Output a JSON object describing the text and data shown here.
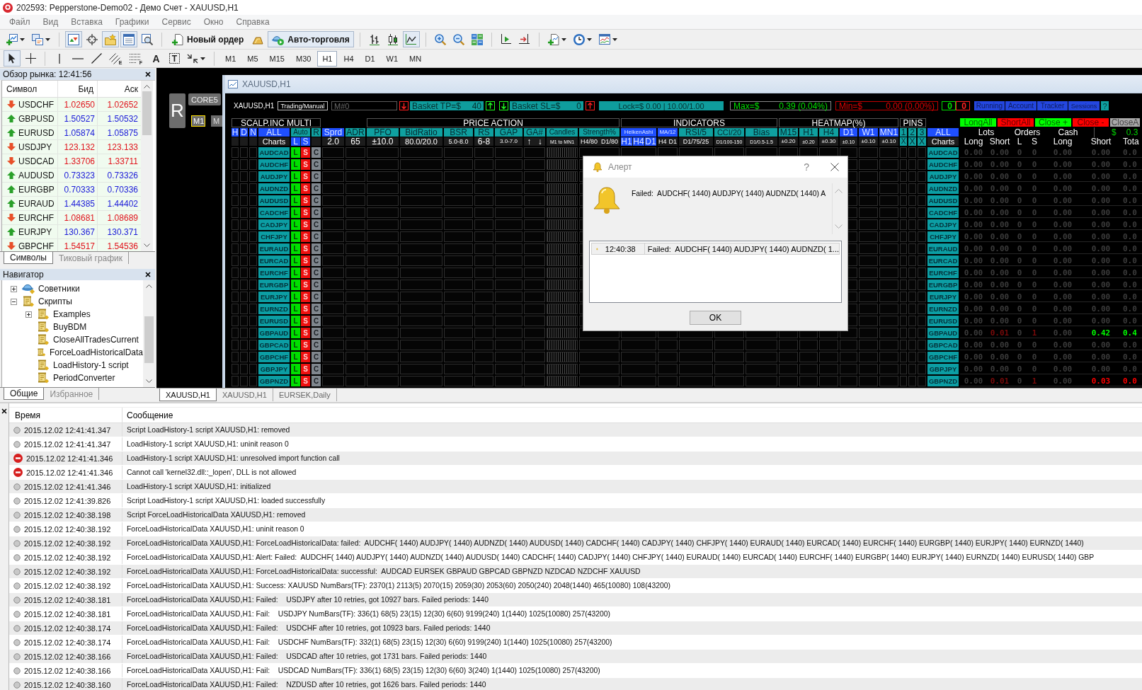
{
  "window": {
    "title": "202593: Pepperstone-Demo02 - Демо Счет - XAUUSD,H1"
  },
  "menu": [
    "Файл",
    "Вид",
    "Вставка",
    "Графики",
    "Сервис",
    "Окно",
    "Справка"
  ],
  "toolbar": [
    [
      {
        "kind": "new-chart",
        "dropdown": true,
        "pressed": false
      },
      {
        "kind": "profiles",
        "dropdown": true,
        "pressed": false
      }
    ],
    [
      {
        "kind": "market-watch",
        "pressed": true
      },
      {
        "kind": "data-window",
        "pressed": false
      },
      {
        "kind": "navigator",
        "pressed": true
      },
      {
        "kind": "terminal",
        "pressed": true
      },
      {
        "kind": "tester",
        "pressed": false
      }
    ],
    [
      {
        "kind": "new-order",
        "label": "Новый ордер",
        "pressed": false
      },
      {
        "kind": "gold",
        "pressed": false
      },
      {
        "kind": "autotrade",
        "label": "Авто-торговля",
        "pressed": true
      }
    ],
    [
      {
        "kind": "bars",
        "pressed": false
      },
      {
        "kind": "candles",
        "pressed": false
      },
      {
        "kind": "line",
        "pressed": true
      }
    ],
    [
      {
        "kind": "zoom-in",
        "pressed": false
      },
      {
        "kind": "zoom-out",
        "pressed": false
      },
      {
        "kind": "tile",
        "pressed": false
      }
    ],
    [
      {
        "kind": "shift",
        "pressed": false
      },
      {
        "kind": "autoscroll",
        "pressed": false
      }
    ],
    [
      {
        "kind": "indicators",
        "dropdown": true,
        "pressed": false
      },
      {
        "kind": "periods",
        "dropdown": true,
        "pressed": false
      },
      {
        "kind": "templates",
        "dropdown": true,
        "pressed": false
      }
    ]
  ],
  "drawing_tools": [
    [
      {
        "kind": "cursor",
        "pressed": true
      },
      {
        "kind": "crosshair",
        "pressed": false
      }
    ],
    [
      {
        "kind": "vline",
        "pressed": false
      },
      {
        "kind": "hline",
        "pressed": false
      },
      {
        "kind": "trendline",
        "pressed": false
      },
      {
        "kind": "channel",
        "glyph": "E",
        "pressed": false
      },
      {
        "kind": "fibo",
        "glyph": "F",
        "pressed": false
      },
      {
        "kind": "text",
        "glyph": "A",
        "pressed": false
      },
      {
        "kind": "label",
        "glyph": "T",
        "pressed": false
      },
      {
        "kind": "arrows",
        "dropdown": true,
        "pressed": false
      }
    ]
  ],
  "timeframes": [
    {
      "label": "M1",
      "selected": false
    },
    {
      "label": "M5",
      "selected": false
    },
    {
      "label": "M15",
      "selected": false
    },
    {
      "label": "M30",
      "selected": false
    },
    {
      "label": "H1",
      "selected": true
    },
    {
      "label": "H4",
      "selected": false
    },
    {
      "label": "D1",
      "selected": false
    },
    {
      "label": "W1",
      "selected": false
    },
    {
      "label": "MN",
      "selected": false
    }
  ],
  "market_watch": {
    "title": "Обзор рынка: 12:41:56",
    "columns": [
      "Символ",
      "Бид",
      "Аск"
    ],
    "rows": [
      {
        "symbol": "USDCHF",
        "bid": "1.02650",
        "ask": "1.02652",
        "rising": false
      },
      {
        "symbol": "GBPUSD",
        "bid": "1.50527",
        "ask": "1.50532",
        "rising": true
      },
      {
        "symbol": "EURUSD",
        "bid": "1.05874",
        "ask": "1.05875",
        "rising": true
      },
      {
        "symbol": "USDJPY",
        "bid": "123.132",
        "ask": "123.133",
        "rising": false
      },
      {
        "symbol": "USDCAD",
        "bid": "1.33706",
        "ask": "1.33711",
        "rising": false
      },
      {
        "symbol": "AUDUSD",
        "bid": "0.73323",
        "ask": "0.73326",
        "rising": true
      },
      {
        "symbol": "EURGBP",
        "bid": "0.70333",
        "ask": "0.70336",
        "rising": true
      },
      {
        "symbol": "EURAUD",
        "bid": "1.44385",
        "ask": "1.44402",
        "rising": true
      },
      {
        "symbol": "EURCHF",
        "bid": "1.08681",
        "ask": "1.08689",
        "rising": false
      },
      {
        "symbol": "EURJPY",
        "bid": "130.367",
        "ask": "130.371",
        "rising": true
      },
      {
        "symbol": "GBPCHF",
        "bid": "1.54517",
        "ask": "1.54536",
        "rising": false
      }
    ],
    "tabs": [
      {
        "label": "Символы",
        "selected": true
      },
      {
        "label": "Тиковый график",
        "selected": false
      }
    ]
  },
  "navigator": {
    "title": "Навигатор",
    "tree": [
      {
        "label": "Советники",
        "kind": "experts",
        "expanded": false
      },
      {
        "label": "Скрипты",
        "kind": "script",
        "expanded": true,
        "children": [
          {
            "label": "Examples",
            "kind": "script",
            "expanded": false
          },
          {
            "label": "BuyBDM",
            "kind": "script"
          },
          {
            "label": "CloseAllTradesCurrent",
            "kind": "script"
          },
          {
            "label": "ForceLoadHistoricalData",
            "kind": "script"
          },
          {
            "label": "LoadHistory-1 script",
            "kind": "script"
          },
          {
            "label": "PeriodConverter",
            "kind": "script"
          }
        ]
      }
    ],
    "tabs": [
      {
        "label": "Общие",
        "selected": true
      },
      {
        "label": "Избранное",
        "selected": false
      }
    ]
  },
  "chart_panel": {
    "refresh": "R",
    "core": "CORE5",
    "periods": [
      {
        "label": "M1",
        "selected": true
      },
      {
        "label": "M",
        "selected": false
      }
    ]
  },
  "chart_window": {
    "title": "XAUUSD,H1",
    "dashboard": {
      "symbol": "XAUUSD,H1",
      "mode": "Trading/Manual",
      "magic": {
        "placeholder": "M#0"
      },
      "basket_tp": {
        "label": "Basket TP=$",
        "value": "40",
        "arrows": [
          {
            "kind": "down",
            "color": "#ff2020"
          },
          {
            "kind": "up",
            "color": "#20ff20"
          }
        ]
      },
      "basket_sl": {
        "label": "Basket SL=$",
        "value": "0",
        "arrows": [
          {
            "kind": "down",
            "color": "#20ff20"
          },
          {
            "kind": "up",
            "color": "#ff2020"
          }
        ]
      },
      "lock": "Lock=$ 0.00 | 10.00/1.00",
      "max": {
        "label": "Max=$",
        "value": "0.39 (0.04%)"
      },
      "min": {
        "label": "Min=$",
        "value": "0.00 (0.00%)"
      },
      "counters": [
        {
          "text": "0",
          "color": "#00e000"
        },
        {
          "text": "0",
          "color": "#ff2020"
        }
      ],
      "tabs": [
        {
          "label": "Running",
          "color": "#2447e0"
        },
        {
          "label": "Account",
          "color": "#2447e0"
        },
        {
          "label": "Tracker",
          "color": "#2447e0"
        },
        {
          "label": "Sessions",
          "color": "#2447e0"
        },
        {
          "label": "?",
          "color": "#0fa0a0"
        }
      ],
      "sections": [
        "SCALP.INC MULTI",
        "PRICE ACTION",
        "INDICATORS",
        "HEATMAP(%)",
        "PINS"
      ],
      "actions": [
        {
          "label": "LongAll",
          "color": "#00ff00"
        },
        {
          "label": "ShortAll",
          "color": "#ff0000"
        },
        {
          "label": "Close +",
          "color": "#00ff00"
        },
        {
          "label": "Close -",
          "color": "#ff0000"
        },
        {
          "label": "CloseA",
          "color": "#a8a8a8"
        }
      ],
      "columns": [
        {
          "header": "H",
          "color": "#1f4fff",
          "kind": "plain"
        },
        {
          "header": "D",
          "color": "#1f4fff",
          "kind": "plain"
        },
        {
          "header": "N",
          "color": "#1f4fff",
          "kind": "plain"
        },
        {
          "header": "ALL",
          "color": "#1f4fff",
          "kind": "symbol",
          "setting": [
            {
              "text": "Charts"
            }
          ]
        },
        {
          "header": "Auto",
          "color": "#0fa0a0",
          "kind": "trade",
          "setting": [
            {
              "text": "L",
              "color": "#1f4fff"
            },
            {
              "text": "S",
              "color": "#1f4fff"
            }
          ]
        },
        {
          "header": "R",
          "color": "#0fa0a0",
          "kind": "close"
        },
        {
          "header": "Sprd",
          "color": "#1f4fff",
          "kind": "plain",
          "setting": [
            {
              "text": "2.0"
            }
          ]
        },
        {
          "header": "ADR",
          "color": "#0fa0a0",
          "kind": "plain",
          "setting": [
            {
              "text": "65"
            }
          ]
        },
        {
          "header": "PFO",
          "color": "#0fa0a0",
          "kind": "plain",
          "setting": [
            {
              "text": "±10.0"
            }
          ]
        },
        {
          "header": "BidRatio",
          "color": "#0fa0a0",
          "kind": "plain",
          "setting": [
            {
              "text": "80.0/20.0"
            }
          ]
        },
        {
          "header": "BSR",
          "color": "#0fa0a0",
          "kind": "plain",
          "setting": [
            {
              "text": "5.0-8.0"
            }
          ]
        },
        {
          "header": "RS",
          "color": "#0fa0a0",
          "kind": "plain",
          "setting": [
            {
              "text": "6-8"
            }
          ]
        },
        {
          "header": "GAP",
          "color": "#0fa0a0",
          "kind": "plain",
          "setting": [
            {
              "text": "3.0-7.0"
            }
          ]
        },
        {
          "header": "GA#",
          "color": "#0fa0a0",
          "kind": "plain",
          "setting": [
            {
              "text": "↑"
            },
            {
              "text": "↓"
            }
          ]
        },
        {
          "header": "Candles",
          "color": "#0fa0a0",
          "kind": "candles",
          "setting": [
            {
              "text": "M1 to MN1"
            }
          ]
        },
        {
          "header": "Strength%",
          "color": "#0fa0a0",
          "kind": "plain",
          "setting": [
            {
              "text": "H4/80"
            },
            {
              "text": "D1/80"
            }
          ]
        },
        {
          "header": "HeikenAshi",
          "color": "#1f4fff",
          "kind": "plain",
          "setting": [
            {
              "text": "H1",
              "color": "#1f4fff"
            },
            {
              "text": "H4",
              "color": "#1f4fff"
            },
            {
              "text": "D1",
              "color": "#1f4fff"
            }
          ]
        },
        {
          "header": "MA/12",
          "color": "#1f4fff",
          "kind": "plain",
          "setting": [
            {
              "text": "H4"
            },
            {
              "text": "D1"
            }
          ]
        },
        {
          "header": "RSI/5",
          "color": "#0fa0a0",
          "kind": "plain",
          "setting": [
            {
              "text": "D1/75/25"
            }
          ]
        },
        {
          "header": "CCI/20",
          "color": "#0fa0a0",
          "kind": "plain",
          "setting": [
            {
              "text": "D1/100-150"
            }
          ]
        },
        {
          "header": "Bias",
          "color": "#0fa0a0",
          "kind": "plain",
          "setting": [
            {
              "text": "D1/0.5-1.5"
            }
          ]
        },
        {
          "header": "M15",
          "color": "#0fa0a0",
          "kind": "plain",
          "setting": [
            {
              "text": "±0.20"
            }
          ]
        },
        {
          "header": "H1",
          "color": "#0fa0a0",
          "kind": "plain",
          "setting": [
            {
              "text": "±0.20"
            }
          ]
        },
        {
          "header": "H4",
          "color": "#0fa0a0",
          "kind": "plain",
          "setting": [
            {
              "text": "±0.30"
            }
          ]
        },
        {
          "header": "D1",
          "color": "#1f4fff",
          "kind": "plain",
          "setting": [
            {
              "text": "±0.10"
            }
          ]
        },
        {
          "header": "W1",
          "color": "#1f4fff",
          "kind": "plain",
          "setting": [
            {
              "text": "±0.10"
            }
          ]
        },
        {
          "header": "MN1",
          "color": "#1f4fff",
          "kind": "plain",
          "setting": [
            {
              "text": "±0.10"
            }
          ]
        },
        {
          "header": "1",
          "color": "#0fa0a0",
          "kind": "plain",
          "setting": [
            {
              "text": "X",
              "color": "#0fa0a0"
            }
          ]
        },
        {
          "header": "2",
          "color": "#0fa0a0",
          "kind": "plain",
          "setting": [
            {
              "text": "X",
              "color": "#0fa0a0"
            }
          ]
        },
        {
          "header": "3",
          "color": "#0fa0a0",
          "kind": "plain",
          "setting": [
            {
              "text": "X",
              "color": "#0fa0a0"
            }
          ]
        },
        {
          "header": "ALL",
          "color": "#1f4fff",
          "kind": "chart",
          "setting": [
            {
              "text": "Charts"
            }
          ]
        }
      ],
      "summary": {
        "groups": [
          "Lots",
          "Orders",
          "Cash"
        ],
        "currency": "$",
        "balance": "0.3",
        "headers": [
          "Long",
          "Short",
          "L",
          "S",
          "Long",
          "Short",
          "Tota"
        ]
      },
      "rows": [
        {
          "symbol": "AUDCAD",
          "trade": [
            "L",
            "S",
            "C"
          ],
          "chart": "AUDCAD",
          "values": [
            {
              "text": "0.00",
              "color": "#3c3c3c"
            },
            {
              "text": "0.00",
              "color": "#3c3c3c"
            },
            {
              "text": "0",
              "color": "#3c3c3c"
            },
            {
              "text": "0",
              "color": "#3c3c3c"
            },
            {
              "text": "0.00",
              "color": "#3c3c3c"
            },
            {
              "text": "0.00",
              "color": "#3c3c3c"
            },
            {
              "text": "0.0",
              "color": "#3c3c3c"
            }
          ]
        },
        {
          "symbol": "AUDCHF",
          "trade": [
            "L",
            "S",
            "C"
          ],
          "chart": "AUDCHF",
          "values": [
            {
              "text": "0.00",
              "color": "#3c3c3c"
            },
            {
              "text": "0.00",
              "color": "#3c3c3c"
            },
            {
              "text": "0",
              "color": "#3c3c3c"
            },
            {
              "text": "0",
              "color": "#3c3c3c"
            },
            {
              "text": "0.00",
              "color": "#3c3c3c"
            },
            {
              "text": "0.00",
              "color": "#3c3c3c"
            },
            {
              "text": "0.0",
              "color": "#3c3c3c"
            }
          ]
        },
        {
          "symbol": "AUDJPY",
          "trade": [
            "L",
            "S",
            "C"
          ],
          "chart": "AUDJPY",
          "values": [
            {
              "text": "0.00",
              "color": "#3c3c3c"
            },
            {
              "text": "0.00",
              "color": "#3c3c3c"
            },
            {
              "text": "0",
              "color": "#3c3c3c"
            },
            {
              "text": "0",
              "color": "#3c3c3c"
            },
            {
              "text": "0.00",
              "color": "#3c3c3c"
            },
            {
              "text": "0.00",
              "color": "#3c3c3c"
            },
            {
              "text": "0.0",
              "color": "#3c3c3c"
            }
          ]
        },
        {
          "symbol": "AUDNZD",
          "trade": [
            "L",
            "S",
            "C"
          ],
          "chart": "AUDNZD",
          "values": [
            {
              "text": "0.00",
              "color": "#3c3c3c"
            },
            {
              "text": "0.00",
              "color": "#3c3c3c"
            },
            {
              "text": "0",
              "color": "#3c3c3c"
            },
            {
              "text": "0",
              "color": "#3c3c3c"
            },
            {
              "text": "0.00",
              "color": "#3c3c3c"
            },
            {
              "text": "0.00",
              "color": "#3c3c3c"
            },
            {
              "text": "0.0",
              "color": "#3c3c3c"
            }
          ]
        },
        {
          "symbol": "AUDUSD",
          "trade": [
            "L",
            "S",
            "C"
          ],
          "chart": "AUDUSD",
          "values": [
            {
              "text": "0.00",
              "color": "#3c3c3c"
            },
            {
              "text": "0.00",
              "color": "#3c3c3c"
            },
            {
              "text": "0",
              "color": "#3c3c3c"
            },
            {
              "text": "0",
              "color": "#3c3c3c"
            },
            {
              "text": "0.00",
              "color": "#3c3c3c"
            },
            {
              "text": "0.00",
              "color": "#3c3c3c"
            },
            {
              "text": "0.0",
              "color": "#3c3c3c"
            }
          ]
        },
        {
          "symbol": "CADCHF",
          "trade": [
            "L",
            "S",
            "C"
          ],
          "chart": "CADCHF",
          "values": [
            {
              "text": "0.00",
              "color": "#3c3c3c"
            },
            {
              "text": "0.00",
              "color": "#3c3c3c"
            },
            {
              "text": "0",
              "color": "#3c3c3c"
            },
            {
              "text": "0",
              "color": "#3c3c3c"
            },
            {
              "text": "0.00",
              "color": "#3c3c3c"
            },
            {
              "text": "0.00",
              "color": "#3c3c3c"
            },
            {
              "text": "0.0",
              "color": "#3c3c3c"
            }
          ]
        },
        {
          "symbol": "CADJPY",
          "trade": [
            "L",
            "S",
            "C"
          ],
          "chart": "CADJPY",
          "values": [
            {
              "text": "0.00",
              "color": "#3c3c3c"
            },
            {
              "text": "0.00",
              "color": "#3c3c3c"
            },
            {
              "text": "0",
              "color": "#3c3c3c"
            },
            {
              "text": "0",
              "color": "#3c3c3c"
            },
            {
              "text": "0.00",
              "color": "#3c3c3c"
            },
            {
              "text": "0.00",
              "color": "#3c3c3c"
            },
            {
              "text": "0.0",
              "color": "#3c3c3c"
            }
          ]
        },
        {
          "symbol": "CHFJPY",
          "trade": [
            "L",
            "S",
            "C"
          ],
          "chart": "CHFJPY",
          "values": [
            {
              "text": "0.00",
              "color": "#3c3c3c"
            },
            {
              "text": "0.00",
              "color": "#3c3c3c"
            },
            {
              "text": "0",
              "color": "#3c3c3c"
            },
            {
              "text": "0",
              "color": "#3c3c3c"
            },
            {
              "text": "0.00",
              "color": "#3c3c3c"
            },
            {
              "text": "0.00",
              "color": "#3c3c3c"
            },
            {
              "text": "0.0",
              "color": "#3c3c3c"
            }
          ]
        },
        {
          "symbol": "EURAUD",
          "trade": [
            "L",
            "S",
            "C"
          ],
          "chart": "EURAUD",
          "values": [
            {
              "text": "0.00",
              "color": "#3c3c3c"
            },
            {
              "text": "0.00",
              "color": "#3c3c3c"
            },
            {
              "text": "0",
              "color": "#3c3c3c"
            },
            {
              "text": "0",
              "color": "#3c3c3c"
            },
            {
              "text": "0.00",
              "color": "#3c3c3c"
            },
            {
              "text": "0.00",
              "color": "#3c3c3c"
            },
            {
              "text": "0.0",
              "color": "#3c3c3c"
            }
          ]
        },
        {
          "symbol": "EURCAD",
          "trade": [
            "L",
            "S",
            "C"
          ],
          "chart": "EURCAD",
          "values": [
            {
              "text": "0.00",
              "color": "#3c3c3c"
            },
            {
              "text": "0.00",
              "color": "#3c3c3c"
            },
            {
              "text": "0",
              "color": "#3c3c3c"
            },
            {
              "text": "0",
              "color": "#3c3c3c"
            },
            {
              "text": "0.00",
              "color": "#3c3c3c"
            },
            {
              "text": "0.00",
              "color": "#3c3c3c"
            },
            {
              "text": "0.0",
              "color": "#3c3c3c"
            }
          ]
        },
        {
          "symbol": "EURCHF",
          "trade": [
            "L",
            "S",
            "C"
          ],
          "chart": "EURCHF",
          "values": [
            {
              "text": "0.00",
              "color": "#3c3c3c"
            },
            {
              "text": "0.00",
              "color": "#3c3c3c"
            },
            {
              "text": "0",
              "color": "#3c3c3c"
            },
            {
              "text": "0",
              "color": "#3c3c3c"
            },
            {
              "text": "0.00",
              "color": "#3c3c3c"
            },
            {
              "text": "0.00",
              "color": "#3c3c3c"
            },
            {
              "text": "0.0",
              "color": "#3c3c3c"
            }
          ]
        },
        {
          "symbol": "EURGBP",
          "trade": [
            "L",
            "S",
            "C"
          ],
          "chart": "EURGBP",
          "values": [
            {
              "text": "0.00",
              "color": "#3c3c3c"
            },
            {
              "text": "0.00",
              "color": "#3c3c3c"
            },
            {
              "text": "0",
              "color": "#3c3c3c"
            },
            {
              "text": "0",
              "color": "#3c3c3c"
            },
            {
              "text": "0.00",
              "color": "#3c3c3c"
            },
            {
              "text": "0.00",
              "color": "#3c3c3c"
            },
            {
              "text": "0.0",
              "color": "#3c3c3c"
            }
          ]
        },
        {
          "symbol": "EURJPY",
          "trade": [
            "L",
            "S",
            "C"
          ],
          "chart": "EURJPY",
          "values": [
            {
              "text": "0.00",
              "color": "#3c3c3c"
            },
            {
              "text": "0.00",
              "color": "#3c3c3c"
            },
            {
              "text": "0",
              "color": "#3c3c3c"
            },
            {
              "text": "0",
              "color": "#3c3c3c"
            },
            {
              "text": "0.00",
              "color": "#3c3c3c"
            },
            {
              "text": "0.00",
              "color": "#3c3c3c"
            },
            {
              "text": "0.0",
              "color": "#3c3c3c"
            }
          ]
        },
        {
          "symbol": "EURNZD",
          "trade": [
            "L",
            "S",
            "C"
          ],
          "chart": "EURNZD",
          "values": [
            {
              "text": "0.00",
              "color": "#3c3c3c"
            },
            {
              "text": "0.00",
              "color": "#3c3c3c"
            },
            {
              "text": "0",
              "color": "#3c3c3c"
            },
            {
              "text": "0",
              "color": "#3c3c3c"
            },
            {
              "text": "0.00",
              "color": "#3c3c3c"
            },
            {
              "text": "0.00",
              "color": "#3c3c3c"
            },
            {
              "text": "0.0",
              "color": "#3c3c3c"
            }
          ]
        },
        {
          "symbol": "EURUSD",
          "trade": [
            "L",
            "S",
            "C"
          ],
          "chart": "EURUSD",
          "values": [
            {
              "text": "0.00",
              "color": "#3c3c3c"
            },
            {
              "text": "0.00",
              "color": "#3c3c3c"
            },
            {
              "text": "0",
              "color": "#3c3c3c"
            },
            {
              "text": "0",
              "color": "#3c3c3c"
            },
            {
              "text": "0.00",
              "color": "#3c3c3c"
            },
            {
              "text": "0.00",
              "color": "#3c3c3c"
            },
            {
              "text": "0.0",
              "color": "#3c3c3c"
            }
          ]
        },
        {
          "symbol": "GBPAUD",
          "trade": [
            "L",
            "S",
            "C"
          ],
          "chart": "GBPAUD",
          "values": [
            {
              "text": "0.00",
              "color": "#3c3c3c"
            },
            {
              "text": "0.01",
              "color": "#7a0a0a"
            },
            {
              "text": "0",
              "color": "#3c3c3c"
            },
            {
              "text": "1",
              "color": "#7a0a0a"
            },
            {
              "text": "0.00",
              "color": "#3c3c3c"
            },
            {
              "text": "0.42",
              "color": "#00ff00"
            },
            {
              "text": "0.4",
              "color": "#00ff00"
            }
          ]
        },
        {
          "symbol": "GBPCAD",
          "trade": [
            "L",
            "S",
            "C"
          ],
          "chart": "GBPCAD",
          "values": [
            {
              "text": "0.00",
              "color": "#3c3c3c"
            },
            {
              "text": "0.00",
              "color": "#3c3c3c"
            },
            {
              "text": "0",
              "color": "#3c3c3c"
            },
            {
              "text": "0",
              "color": "#3c3c3c"
            },
            {
              "text": "0.00",
              "color": "#3c3c3c"
            },
            {
              "text": "0.00",
              "color": "#3c3c3c"
            },
            {
              "text": "0.0",
              "color": "#3c3c3c"
            }
          ]
        },
        {
          "symbol": "GBPCHF",
          "trade": [
            "L",
            "S",
            "C"
          ],
          "chart": "GBPCHF",
          "values": [
            {
              "text": "0.00",
              "color": "#3c3c3c"
            },
            {
              "text": "0.00",
              "color": "#3c3c3c"
            },
            {
              "text": "0",
              "color": "#3c3c3c"
            },
            {
              "text": "0",
              "color": "#3c3c3c"
            },
            {
              "text": "0.00",
              "color": "#3c3c3c"
            },
            {
              "text": "0.00",
              "color": "#3c3c3c"
            },
            {
              "text": "0.0",
              "color": "#3c3c3c"
            }
          ]
        },
        {
          "symbol": "GBPJPY",
          "trade": [
            "L",
            "S",
            "C"
          ],
          "chart": "GBPJPY",
          "values": [
            {
              "text": "0.00",
              "color": "#3c3c3c"
            },
            {
              "text": "0.00",
              "color": "#3c3c3c"
            },
            {
              "text": "0",
              "color": "#3c3c3c"
            },
            {
              "text": "0",
              "color": "#3c3c3c"
            },
            {
              "text": "0.00",
              "color": "#3c3c3c"
            },
            {
              "text": "0.00",
              "color": "#3c3c3c"
            },
            {
              "text": "0.0",
              "color": "#3c3c3c"
            }
          ]
        },
        {
          "symbol": "GBPNZD",
          "trade": [
            "L",
            "S",
            "C"
          ],
          "chart": "GBPNZD",
          "values": [
            {
              "text": "0.00",
              "color": "#3c3c3c"
            },
            {
              "text": "0.01",
              "color": "#7a0a0a"
            },
            {
              "text": "0",
              "color": "#3c3c3c"
            },
            {
              "text": "1",
              "color": "#7a0a0a"
            },
            {
              "text": "0.00",
              "color": "#3c3c3c"
            },
            {
              "text": "0.03",
              "color": "#ff0000"
            },
            {
              "text": "0.0",
              "color": "#ff0000"
            }
          ]
        }
      ]
    }
  },
  "alert": {
    "title": "Алерт",
    "help": "?",
    "message": "Failed:  AUDCHF( 1440) AUDJPY( 1440) AUDNZD( 1440) A",
    "entries": [
      {
        "time": "12:40:38",
        "message": "Failed:  AUDCHF( 1440) AUDJPY( 1440) AUDNZD( 1..."
      }
    ],
    "ok": "OK"
  },
  "chart_tabs": [
    {
      "label": "XAUUSD,H1",
      "selected": true
    },
    {
      "label": "XAUUSD,H1",
      "selected": false
    },
    {
      "label": "EURSEK,Daily",
      "selected": false
    }
  ],
  "terminal": {
    "columns": [
      "Время",
      "Сообщение"
    ],
    "rows": [
      {
        "kind": "info",
        "time": "2015.12.02 12:41:41.347",
        "message": "Script LoadHistory-1 script XAUUSD,H1: removed"
      },
      {
        "kind": "info",
        "time": "2015.12.02 12:41:41.347",
        "message": "LoadHistory-1 script XAUUSD,H1: uninit reason 0"
      },
      {
        "kind": "error",
        "time": "2015.12.02 12:41:41.346",
        "message": "LoadHistory-1 script XAUUSD,H1: unresolved import function call"
      },
      {
        "kind": "error",
        "time": "2015.12.02 12:41:41.346",
        "message": "Cannot call 'kernel32.dll::_lopen', DLL is not allowed"
      },
      {
        "kind": "info",
        "time": "2015.12.02 12:41:41.346",
        "message": "LoadHistory-1 script XAUUSD,H1: initialized"
      },
      {
        "kind": "info",
        "time": "2015.12.02 12:41:39.826",
        "message": "Script LoadHistory-1 script XAUUSD,H1: loaded successfully"
      },
      {
        "kind": "info",
        "time": "2015.12.02 12:40:38.198",
        "message": "Script ForceLoadHistoricalData XAUUSD,H1: removed"
      },
      {
        "kind": "info",
        "time": "2015.12.02 12:40:38.192",
        "message": "ForceLoadHistoricalData XAUUSD,H1: uninit reason 0"
      },
      {
        "kind": "info",
        "time": "2015.12.02 12:40:38.192",
        "message": "ForceLoadHistoricalData XAUUSD,H1: ForceLoadHistoricalData: failed:  AUDCHF( 1440) AUDJPY( 1440) AUDNZD( 1440) AUDUSD( 1440) CADCHF( 1440) CADJPY( 1440) CHFJPY( 1440) EURAUD( 1440) EURCAD( 1440) EURCHF( 1440) EURGBP( 1440) EURJPY( 1440) EURNZD( 1440)"
      },
      {
        "kind": "info",
        "time": "2015.12.02 12:40:38.192",
        "message": "ForceLoadHistoricalData XAUUSD,H1: Alert: Failed:  AUDCHF( 1440) AUDJPY( 1440) AUDNZD( 1440) AUDUSD( 1440) CADCHF( 1440) CADJPY( 1440) CHFJPY( 1440) EURAUD( 1440) EURCAD( 1440) EURCHF( 1440) EURGBP( 1440) EURJPY( 1440) EURNZD( 1440) EURUSD( 1440) GBP"
      },
      {
        "kind": "info",
        "time": "2015.12.02 12:40:38.192",
        "message": "ForceLoadHistoricalData XAUUSD,H1: ForceLoadHistoricalData: successful:  AUDCAD EURSEK GBPAUD GBPCAD GBPNZD NZDCAD NZDCHF XAUUSD"
      },
      {
        "kind": "info",
        "time": "2015.12.02 12:40:38.192",
        "message": "ForceLoadHistoricalData XAUUSD,H1: Success: XAUUSD NumBars(TF): 2370(1) 2113(5) 2070(15) 2059(30) 2053(60) 2050(240) 2048(1440) 465(10080) 108(43200)"
      },
      {
        "kind": "info",
        "time": "2015.12.02 12:40:38.181",
        "message": "ForceLoadHistoricalData XAUUSD,H1: Failed:    USDJPY after 10 retries, got 10927 bars. Failed periods: 1440"
      },
      {
        "kind": "info",
        "time": "2015.12.02 12:40:38.181",
        "message": "ForceLoadHistoricalData XAUUSD,H1: Fail:    USDJPY NumBars(TF): 336(1) 68(5) 23(15) 12(30) 6(60) 9199(240) 1(1440) 1025(10080) 257(43200)"
      },
      {
        "kind": "info",
        "time": "2015.12.02 12:40:38.174",
        "message": "ForceLoadHistoricalData XAUUSD,H1: Failed:    USDCHF after 10 retries, got 10923 bars. Failed periods: 1440"
      },
      {
        "kind": "info",
        "time": "2015.12.02 12:40:38.174",
        "message": "ForceLoadHistoricalData XAUUSD,H1: Fail:    USDCHF NumBars(TF): 332(1) 68(5) 23(15) 12(30) 6(60) 9199(240) 1(1440) 1025(10080) 257(43200)"
      },
      {
        "kind": "info",
        "time": "2015.12.02 12:40:38.166",
        "message": "ForceLoadHistoricalData XAUUSD,H1: Failed:    USDCAD after 10 retries, got 1731 bars. Failed periods: 1440"
      },
      {
        "kind": "info",
        "time": "2015.12.02 12:40:38.166",
        "message": "ForceLoadHistoricalData XAUUSD,H1: Fail:    USDCAD NumBars(TF): 336(1) 68(5) 23(15) 12(30) 6(60) 3(240) 1(1440) 1025(10080) 257(43200)"
      },
      {
        "kind": "info",
        "time": "2015.12.02 12:40:38.160",
        "message": "ForceLoadHistoricalData XAUUSD,H1: Failed:    NZDUSD after 10 retries, got 1626 bars. Failed periods: 1440"
      }
    ]
  }
}
